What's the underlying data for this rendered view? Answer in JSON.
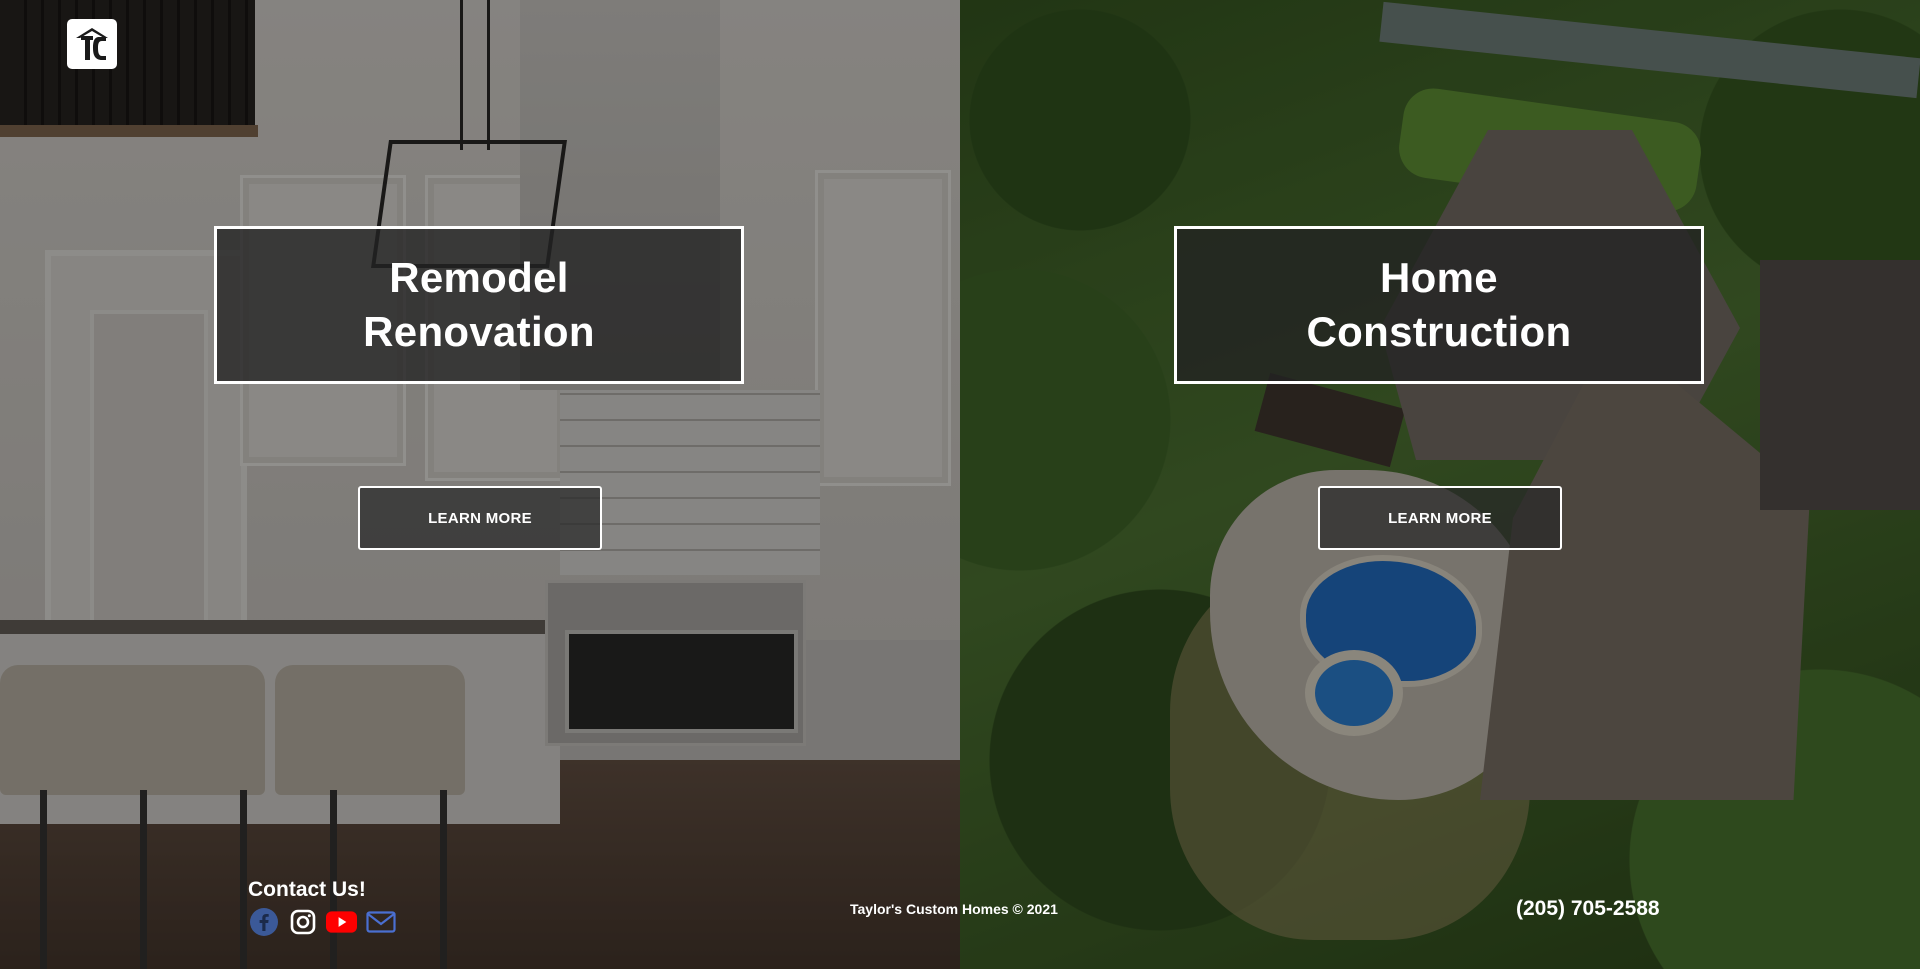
{
  "brand": {
    "logo_label": "TC"
  },
  "services": [
    {
      "title_line1": "Remodel",
      "title_line2": "Renovation",
      "button_label": "LEARN MORE"
    },
    {
      "title_line1": "Home",
      "title_line2": "Construction",
      "button_label": "LEARN MORE"
    }
  ],
  "footer": {
    "contact_title": "Contact Us!",
    "social_icons": [
      "facebook-icon",
      "instagram-icon",
      "youtube-icon",
      "mail-icon"
    ],
    "copyright": "Taylor's Custom Homes © 2021",
    "phone": "(205) 705-2588"
  },
  "colors": {
    "facebook": "#3b5998",
    "youtube": "#ff0000",
    "mail": "#4a6fd1",
    "card_border": "#ffffff"
  }
}
